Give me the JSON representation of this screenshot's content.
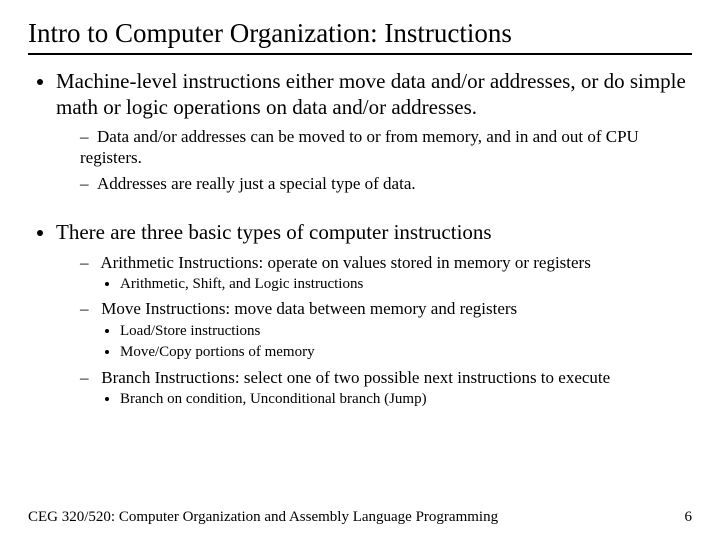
{
  "title": "Intro to Computer Organization: Instructions",
  "p1": {
    "text": "Machine-level instructions either move data and/or addresses, or do simple math or logic operations on data and/or addresses.",
    "sub1": "Data and/or addresses can be moved to or from memory, and in and out of CPU registers.",
    "sub2": "Addresses are really just a special type of data."
  },
  "p2": {
    "text": "There are three basic types of computer instructions",
    "arith": {
      "text": "Arithmetic Instructions:  operate on values stored in memory or registers",
      "b1": "Arithmetic, Shift, and Logic instructions"
    },
    "move": {
      "text": "Move Instructions: move data between memory and registers",
      "b1": "Load/Store instructions",
      "b2": "Move/Copy portions of memory"
    },
    "branch": {
      "text": "Branch Instructions: select one of two possible next instructions to execute",
      "b1": "Branch on condition, Unconditional branch (Jump)"
    }
  },
  "footer": {
    "course": "CEG 320/520: Computer Organization and Assembly Language Programming",
    "page": "6"
  }
}
